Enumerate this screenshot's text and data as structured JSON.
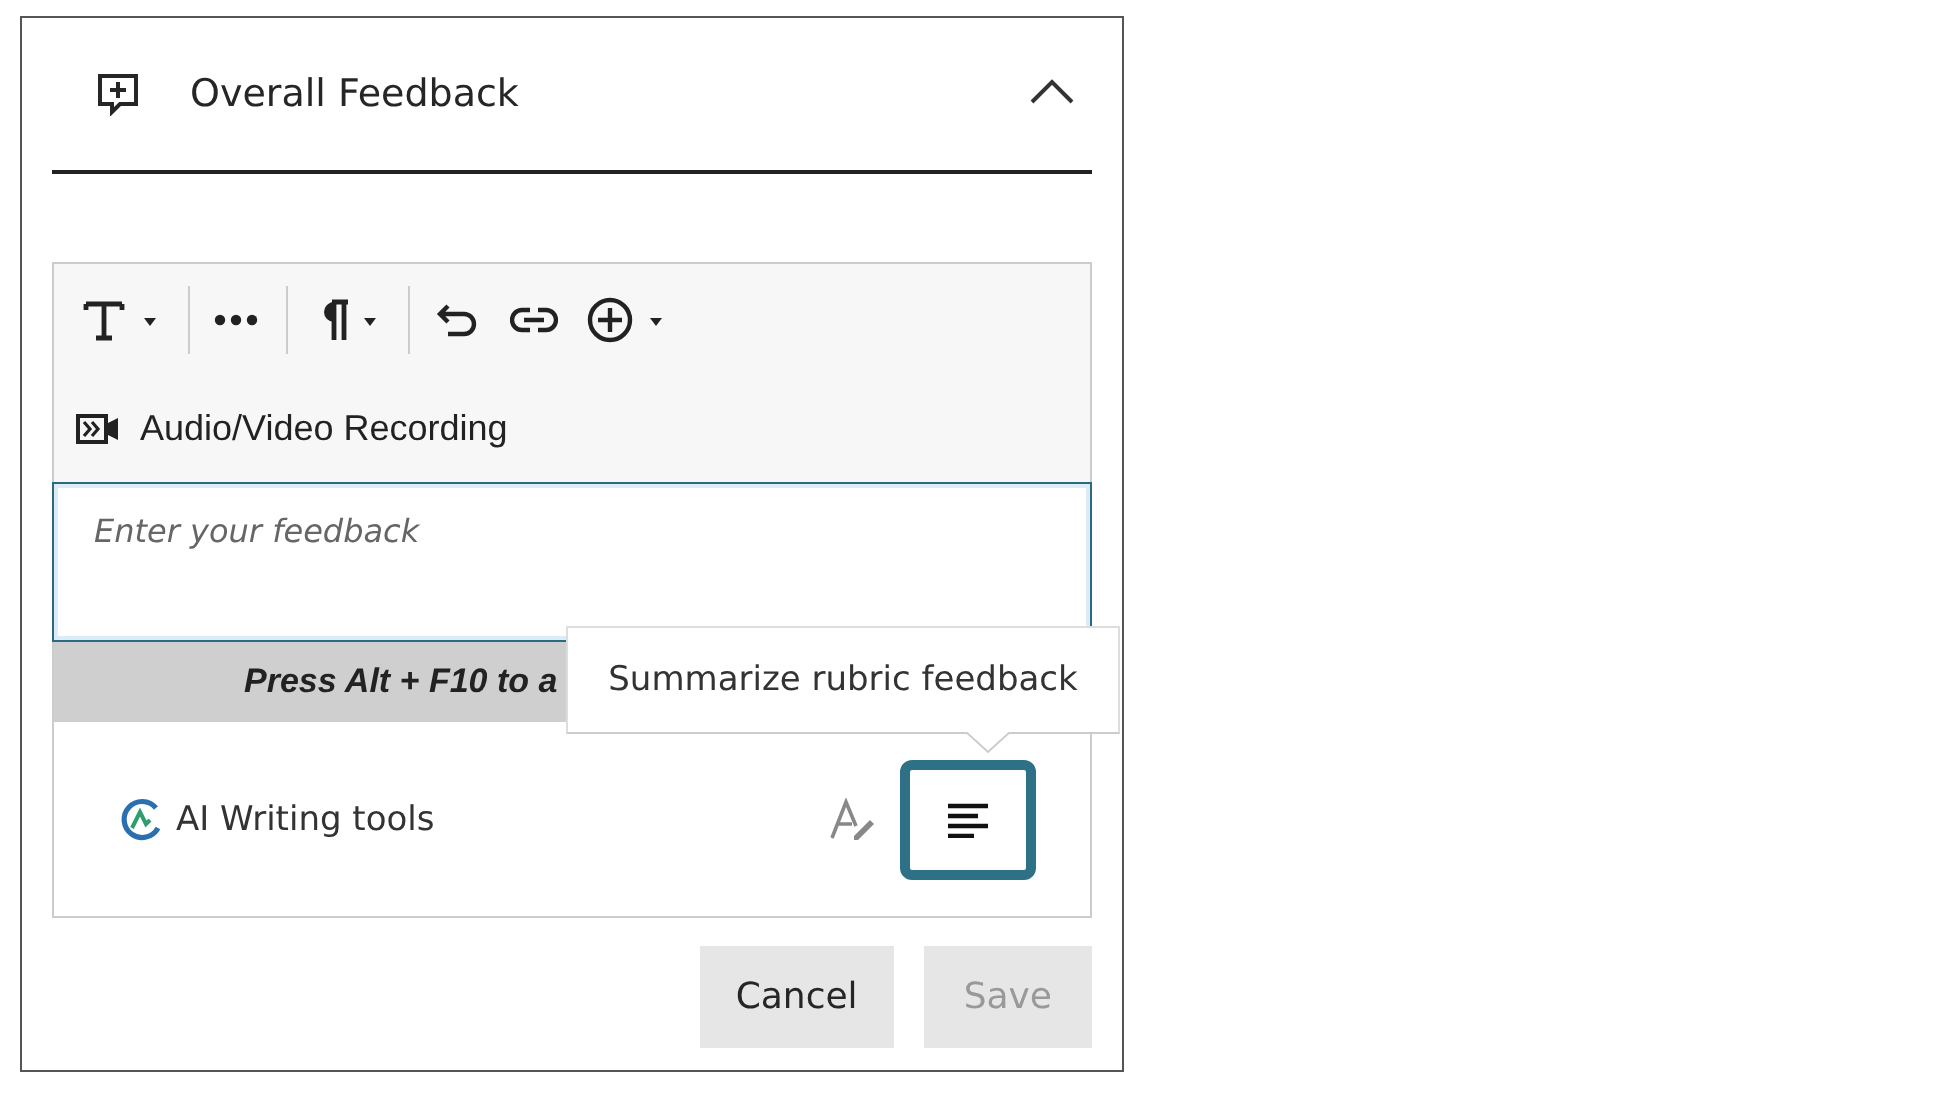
{
  "section": {
    "title": "Overall Feedback",
    "expanded": true
  },
  "editor": {
    "recording_label": "Audio/Video Recording",
    "placeholder": "Enter your feedback",
    "hint": "Press Alt + F10 to a"
  },
  "ai_tools": {
    "label": "AI Writing tools",
    "summarize_focused": true
  },
  "tooltip": "Summarize rubric feedback",
  "buttons": [
    {
      "label": "Cancel",
      "disabled": false
    },
    {
      "label": "Save",
      "disabled": true
    }
  ]
}
